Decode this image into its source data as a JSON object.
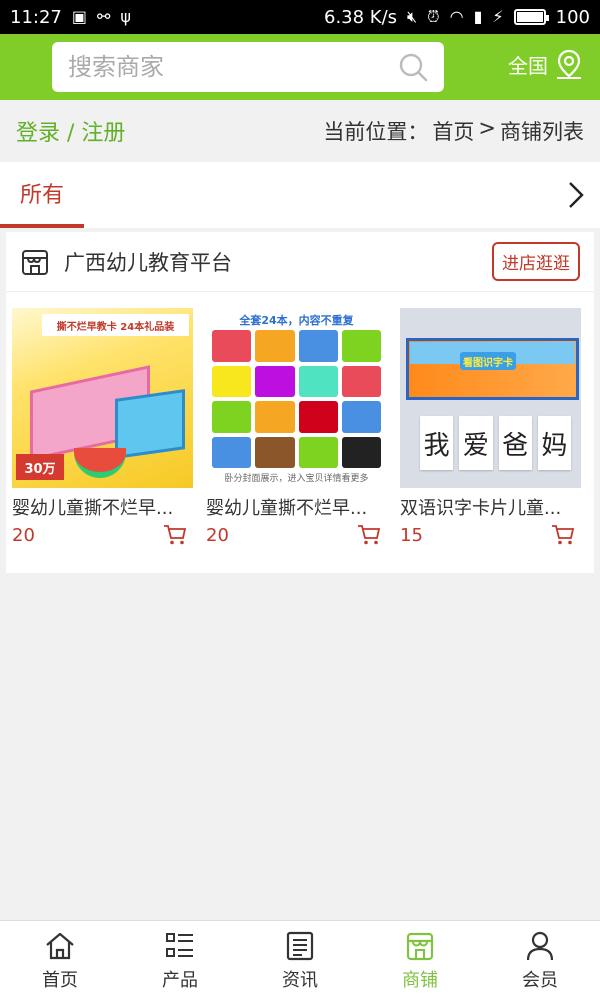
{
  "status_bar": {
    "time": "11:27",
    "speed": "6.38 K/s",
    "battery": "100"
  },
  "header": {
    "search_placeholder": "搜索商家",
    "region": "全国"
  },
  "crumb": {
    "login": "登录 / 注册",
    "label": "当前位置：",
    "home": "首页",
    "separator": ">",
    "current": "商铺列表"
  },
  "tabs": {
    "active": "所有"
  },
  "shop": {
    "name": "广西幼儿教育平台",
    "visit_button": "进店逛逛",
    "products": [
      {
        "title": "婴幼儿童撕不烂早...",
        "price": "20",
        "image_text": "撕不烂早教卡 24本礼品装",
        "image_tag": "30万"
      },
      {
        "title": "婴幼儿童撕不烂早...",
        "price": "20",
        "image_text": "全套24本，内容不重复",
        "image_caption": "卧分封面展示，进入宝贝详情看更多"
      },
      {
        "title": "双语识字卡片儿童...",
        "price": "15",
        "image_sign": "看图识字卡",
        "image_cards": [
          "我",
          "爱",
          "爸",
          "妈"
        ]
      }
    ]
  },
  "bottom_nav": [
    {
      "label": "首页",
      "icon": "home-icon"
    },
    {
      "label": "产品",
      "icon": "list-icon"
    },
    {
      "label": "资讯",
      "icon": "news-icon"
    },
    {
      "label": "商铺",
      "icon": "shop-icon",
      "active": true
    },
    {
      "label": "会员",
      "icon": "user-icon"
    }
  ],
  "colors": {
    "brand_green": "#80cc28",
    "accent_red": "#c0392b",
    "nav_active": "#80c341"
  }
}
